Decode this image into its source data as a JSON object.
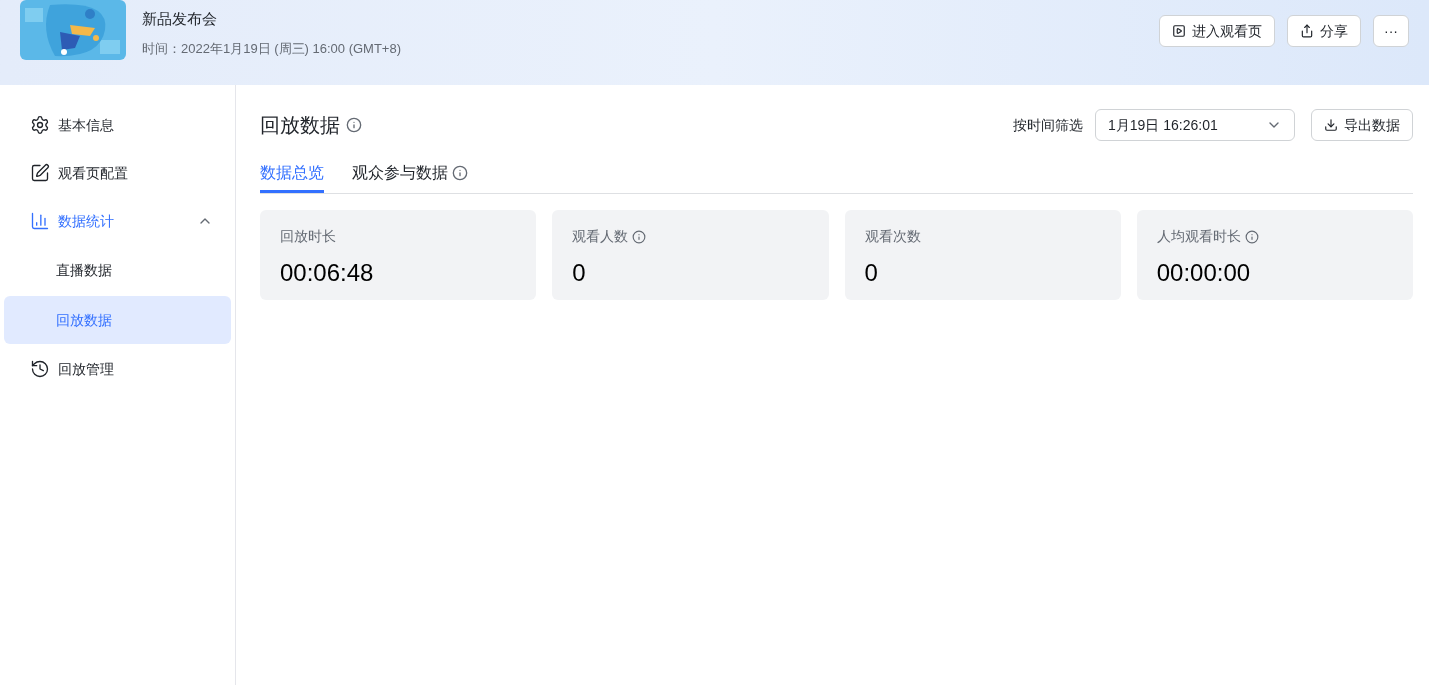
{
  "header": {
    "title": "新品发布会",
    "time": "时间：2022年1月19日 (周三) 16:00 (GMT+8)",
    "actions": [
      {
        "kind": "watch",
        "label": "进入观看页"
      },
      {
        "kind": "share",
        "label": "分享"
      },
      {
        "kind": "more",
        "label": "···"
      }
    ]
  },
  "sidebar": {
    "items": [
      {
        "label": "基本信息",
        "selected": false
      },
      {
        "label": "观看页配置",
        "selected": false
      },
      {
        "label": "数据统计",
        "selected": true,
        "expanded": true,
        "children": [
          {
            "label": "直播数据",
            "selected": false
          },
          {
            "label": "回放数据",
            "selected": true
          }
        ]
      },
      {
        "label": "回放管理",
        "selected": false
      }
    ]
  },
  "page": {
    "title": "回放数据",
    "filter_label": "按时间筛选",
    "filter_value": "1月19日 16:26:01",
    "export_button": "导出数据",
    "tabs": [
      {
        "label": "数据总览",
        "selected": true,
        "info": false
      },
      {
        "label": "观众参与数据",
        "selected": false,
        "info": true
      }
    ],
    "stats": [
      {
        "label": "回放时长",
        "value": "00:06:48",
        "info": false
      },
      {
        "label": "观看人数",
        "value": "0",
        "info": true
      },
      {
        "label": "观看次数",
        "value": "0",
        "info": false
      },
      {
        "label": "人均观看时长",
        "value": "00:00:00",
        "info": true
      }
    ]
  }
}
